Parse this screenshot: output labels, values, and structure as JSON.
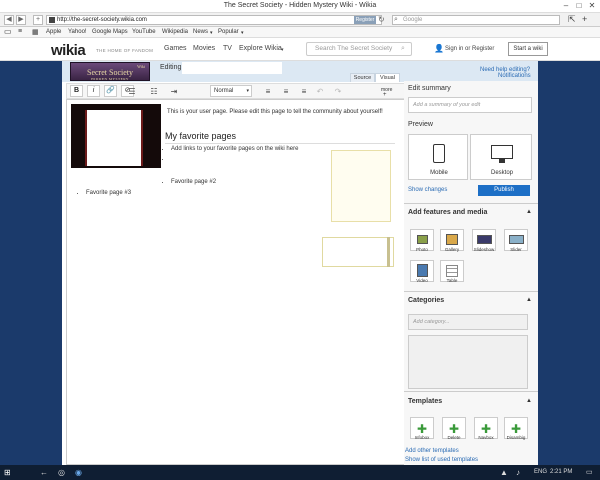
{
  "window": {
    "title": "The Secret Society - Hidden Mystery Wiki - Wikia"
  },
  "browser": {
    "url": "http://the-secret-society.wikia.com",
    "register_label": "Register",
    "search_placeholder": "Google",
    "bookmarks": [
      "Apple",
      "Yahoo!",
      "Google Maps",
      "YouTube",
      "Wikipedia",
      "News",
      "Popular"
    ]
  },
  "global_nav": {
    "logo": "wikia",
    "tagline": "THE HOME OF FANDOM",
    "links": [
      "Games",
      "Movies",
      "TV",
      "Explore Wikia"
    ],
    "search_placeholder": "Search The Secret Society",
    "sign_in": "Sign in",
    "or": "or",
    "register": "Register",
    "start_wiki": "Start a wiki"
  },
  "editor": {
    "banner_small": "Wiki",
    "banner_title": "Secret Society",
    "banner_sub": "HIDDEN MYSTERY",
    "editing_label": "Editing",
    "tabs": [
      "Source",
      "Visual"
    ],
    "help_text": "Need help editing?",
    "notifications": "Notifications",
    "format": "Normal",
    "more": "more",
    "intro": "This is your user page. Please edit this page to tell the community about yourself!",
    "heading": "My favorite pages",
    "bullets": [
      "Add links to your favorite pages on the wiki here",
      "",
      "Favorite page #2",
      "Favorite page #3"
    ]
  },
  "sidebar": {
    "edit_summary": "Edit summary",
    "summary_placeholder": "Add a summary of your edit",
    "preview": "Preview",
    "mobile": "Mobile",
    "desktop": "Desktop",
    "show_changes": "Show changes",
    "publish": "Publish",
    "add_features": "Add features and media",
    "features": [
      "Photo",
      "Gallery",
      "Slideshow",
      "Slider",
      "Video",
      "Table"
    ],
    "categories": "Categories",
    "category_placeholder": "Add category...",
    "templates": "Templates",
    "template_items": [
      "Infobox",
      "Delete",
      "Navbox",
      "Disambig"
    ],
    "add_templates": "Add other templates",
    "show_templates": "Show list of used templates"
  },
  "taskbar": {
    "lang": "ENG",
    "time": "2:21 PM"
  }
}
